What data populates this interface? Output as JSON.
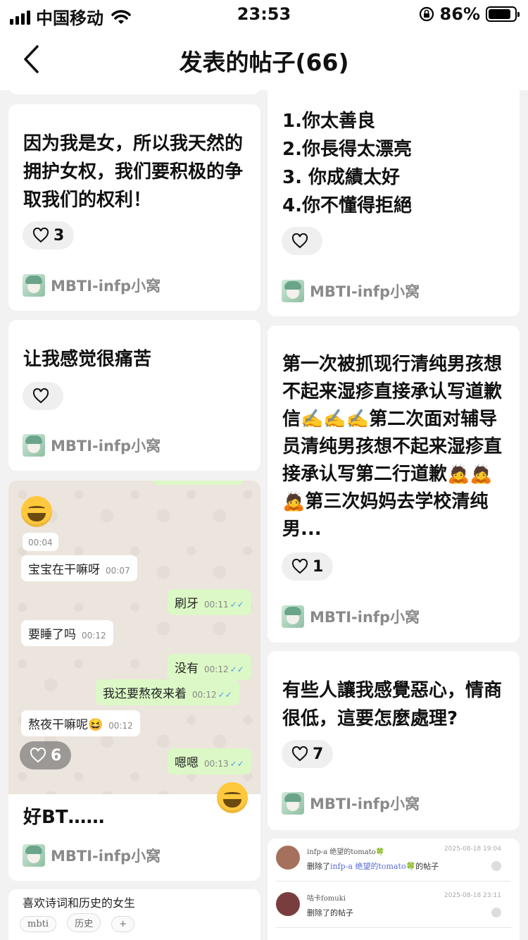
{
  "status_bar": {
    "carrier": "中国移动",
    "time": "23:53",
    "battery_pct": "86%"
  },
  "nav": {
    "title": "发表的帖子(66)"
  },
  "posts_left": [
    {
      "text": "因为我是女，所以我天然的拥护女权，我们要积极的争取我们的权利！",
      "likes": "3",
      "author": "MBTI-infp小窝"
    },
    {
      "text": "让我感觉很痛苦",
      "likes": "",
      "author": "MBTI-infp小窝"
    },
    {
      "text": "好BT……",
      "likes": "6",
      "author": "MBTI-infp小窝",
      "chat": [
        {
          "dir": "in",
          "text": "宝宝在干嘛呀",
          "time": "00:07"
        },
        {
          "dir": "out",
          "text": "刷牙",
          "time": "00:11"
        },
        {
          "dir": "in",
          "text": "要睡了吗",
          "time": "00:12"
        },
        {
          "dir": "out",
          "text": "没有",
          "time": "00:12"
        },
        {
          "dir": "out",
          "text": "我还要熬夜来着",
          "time": "00:12"
        },
        {
          "dir": "in",
          "text": "熬夜干嘛呢😆",
          "time": "00:12"
        },
        {
          "dir": "out",
          "text": "嗯嗯",
          "time": "00:13"
        }
      ],
      "chat_first_time": "00:04"
    },
    {
      "text": "喜欢诗词和历史的女生",
      "tags": [
        "mbti",
        "历史",
        "+"
      ]
    }
  ],
  "posts_right": [
    {
      "text_lines": [
        "1.你太善良",
        "2.你長得太漂亮",
        "3. 你成績太好",
        "4.你不懂得拒絕"
      ],
      "likes": "",
      "author": "MBTI-infp小窝"
    },
    {
      "text": "第一次被抓现行清纯男孩想不起来湿疹直接承认写道歉信✍️✍️✍️第二次面对辅导员清纯男孩想不起来湿疹直接承认写第二行道歉🙇🙇🙇第三次妈妈去学校清纯男...",
      "likes": "1",
      "author": "MBTI-infp小窝"
    },
    {
      "text": "有些人讓我感覺惡心，情商很低，這要怎麼處理?",
      "likes": "7",
      "author": "MBTI-infp小窝"
    },
    {
      "notifications": [
        {
          "name": "infp-a 绝望的tomato🍀",
          "time": "2025-08-18 19:04",
          "prefix": "删除了",
          "target": "infp-a 绝望的tomato🍀",
          "suffix": "的帖子"
        },
        {
          "name": "咕卡fomuki",
          "time": "2025-08-18 23:11",
          "prefix": "删除了",
          "target": "",
          "suffix": "的帖子"
        }
      ]
    }
  ],
  "colors": {
    "background": "#f2f2f2",
    "card": "#ffffff",
    "like_pill": "#efefef",
    "author_text": "#8a8a8a"
  }
}
